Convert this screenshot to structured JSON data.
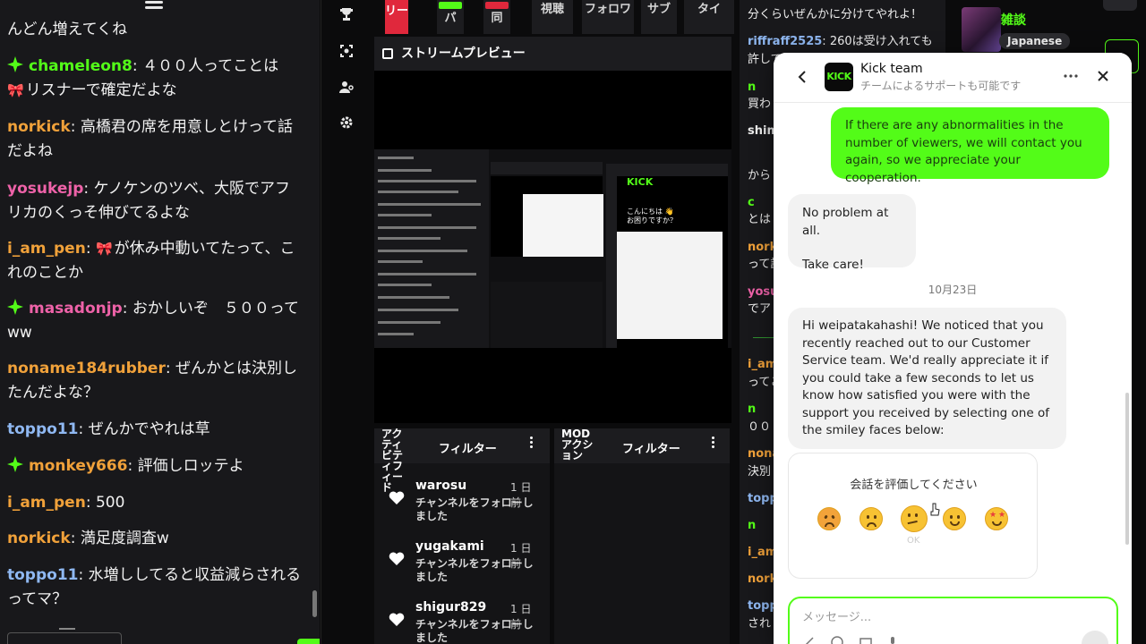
{
  "left_chat": {
    "messages": [
      {
        "user": "",
        "text": "んどん増えてくね"
      },
      {
        "user": "chameleon8",
        "text": "４００人ってことは",
        "text2": "リスナーで確定だよな",
        "color": "#53fc18",
        "badge": "gem-icon",
        "ribbon": true
      },
      {
        "user": "norkick",
        "text": "高橋君の席を用意しとけって話だよね",
        "color": "#f0a13a"
      },
      {
        "user": "yosukejp",
        "text": "ケノケンのツベ、大阪でアフリカのくっそ伸びてるよな",
        "color": "#ee62a8"
      },
      {
        "user": "i_am_pen",
        "text": "が休み中動いてたって、これのことか",
        "color": "#f0a13a",
        "ribbon": true
      },
      {
        "user": "masadonjp",
        "text": "おかしいぞ　５００ってww",
        "color": "#ee62a8",
        "badge": "gem-icon"
      },
      {
        "user": "noname184rubber",
        "text": "ぜんかとは決別したんだよな？",
        "color": "#f0a13a"
      },
      {
        "user": "toppo11",
        "text": "ぜんかでやれは草",
        "color": "#8fb8f2"
      },
      {
        "user": "monkey666",
        "text": "評価しロッテよ",
        "color": "#f0a13a",
        "badge": "gem-icon"
      },
      {
        "user": "i_am_pen",
        "text": "500",
        "color": "#f0a13a"
      },
      {
        "user": "norkick",
        "text": "満足度調査w",
        "color": "#f0a13a"
      },
      {
        "user": "toppo11",
        "text": "水増ししてると収益減らされるってマ？",
        "color": "#8fb8f2"
      }
    ]
  },
  "icon_column": {
    "icons": [
      "trophy-icon",
      "screen-capture-icon",
      "user-settings-icon",
      "gear-icon"
    ]
  },
  "dashboard": {
    "top_buttons": [
      "リー",
      "パ",
      "同",
      "視聴",
      "フォロワ",
      "サブ",
      "タイ"
    ],
    "preview_title": "ストリームプレビュー",
    "activity_panel": {
      "title_vertical": "アクティビティフィード",
      "filter_label": "フィルター",
      "items": [
        {
          "user": "warosu",
          "time": "1 日前",
          "desc": "チャンネルをフォローしました"
        },
        {
          "user": "yugakami",
          "time": "1 日前",
          "desc": "チャンネルをフォローしました"
        },
        {
          "user": "shigur829",
          "time": "1 日前",
          "desc": "チャンネルをフォローしました"
        }
      ]
    },
    "mod_panel": {
      "title": "MOD アクション",
      "filter_label": "フィルター"
    }
  },
  "right_chat": {
    "messages": [
      {
        "user": "",
        "text": "分くらいぜんかに分けてやれよ！"
      },
      {
        "user": "riffraff2525",
        "text": "260は受け入れても",
        "color": "#8fb8f2"
      },
      {
        "user": "",
        "text": "許して"
      },
      {
        "user": "n",
        "text": "",
        "color": "#53fc18"
      },
      {
        "user": "",
        "text": "買わ"
      },
      {
        "user": "shim",
        "text": "",
        "color": "#eeeeee"
      },
      {
        "user": "",
        "text": "から"
      },
      {
        "user": "c",
        "text": "",
        "color": "#53fc18"
      },
      {
        "user": "",
        "text": "とは"
      },
      {
        "user": "nork",
        "text": "",
        "color": "#f0a13a"
      },
      {
        "user": "",
        "text": "って語"
      },
      {
        "user": "yosu",
        "text": "",
        "color": "#ee62a8"
      },
      {
        "user": "",
        "text": "でア"
      },
      {
        "user": "i_am",
        "text": "",
        "color": "#f0a13a"
      },
      {
        "user": "",
        "text": "ってこ"
      },
      {
        "user": "n",
        "text": "",
        "color": "#53fc18"
      },
      {
        "user": "",
        "text": "００"
      },
      {
        "user": "nona",
        "text": "",
        "color": "#f0a13a"
      },
      {
        "user": "",
        "text": "決別"
      },
      {
        "user": "topp",
        "text": "",
        "color": "#8fb8f2"
      },
      {
        "user": "n",
        "text": "",
        "color": "#53fc18"
      },
      {
        "user": "i_am",
        "text": "",
        "color": "#f0a13a"
      },
      {
        "user": "nork",
        "text": "",
        "color": "#f0a13a"
      },
      {
        "user": "topp",
        "text": "",
        "color": "#8fb8f2"
      },
      {
        "user": "",
        "text": "され"
      }
    ]
  },
  "category": {
    "title": "雑談",
    "tag": "Japanese"
  },
  "support_widget": {
    "team_name": "Kick team",
    "subtitle": "チームによるサポートも可能です",
    "logo_text": "KICK",
    "messages": {
      "outgoing_1": "If there are any abnormalities in the number of viewers, we will contact you again, so we appreciate your cooperation.",
      "incoming_1_line1": "No problem at all.",
      "incoming_1_line2": "Take care!",
      "date": "10月23日",
      "incoming_2": "Hi weipatakahashi! We noticed that you recently reached out to our Customer Service team. We'd really appreciate it if you could take a few seconds to let us know how satisfied you were with the support you received by selecting one of the smiley faces below:"
    },
    "rating": {
      "title": "会話を評価してください",
      "hover_label": "OK",
      "faces": [
        "angry-face-icon",
        "sad-face-icon",
        "neutral-face-icon",
        "smile-face-icon",
        "star-eyes-face-icon"
      ]
    },
    "composer": {
      "placeholder": "メッセージ..."
    },
    "colors": {
      "accent": "#53fc18"
    }
  }
}
